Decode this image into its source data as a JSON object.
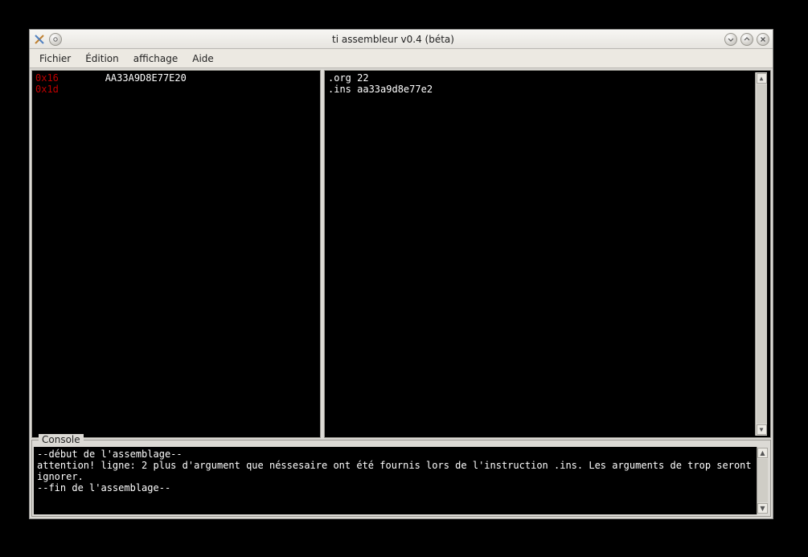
{
  "window": {
    "title": "ti assembleur v0.4 (béta)"
  },
  "menu": {
    "file": "Fichier",
    "edit": "Édition",
    "view": "affichage",
    "help": "Aide"
  },
  "hexview": {
    "rows": [
      {
        "addr": "0x16",
        "bytes": "AA33A9D8E77E20"
      },
      {
        "addr": "0x1d",
        "bytes": ""
      }
    ]
  },
  "source": {
    "lines": [
      ".org 22",
      ".ins aa33a9d8e77e2"
    ]
  },
  "console": {
    "label": "Console",
    "lines": [
      "--début de l'assemblage--",
      "attention! ligne: 2 plus d'argument que néssesaire ont été fournis lors de l'instruction .ins. Les arguments de trop seront ignorer.",
      "--fin de l'assemblage--"
    ]
  },
  "icons": {
    "app": "app-icon",
    "roll": "rollup-icon",
    "min": "minimize-icon",
    "max": "maximize-icon",
    "close": "close-icon"
  }
}
